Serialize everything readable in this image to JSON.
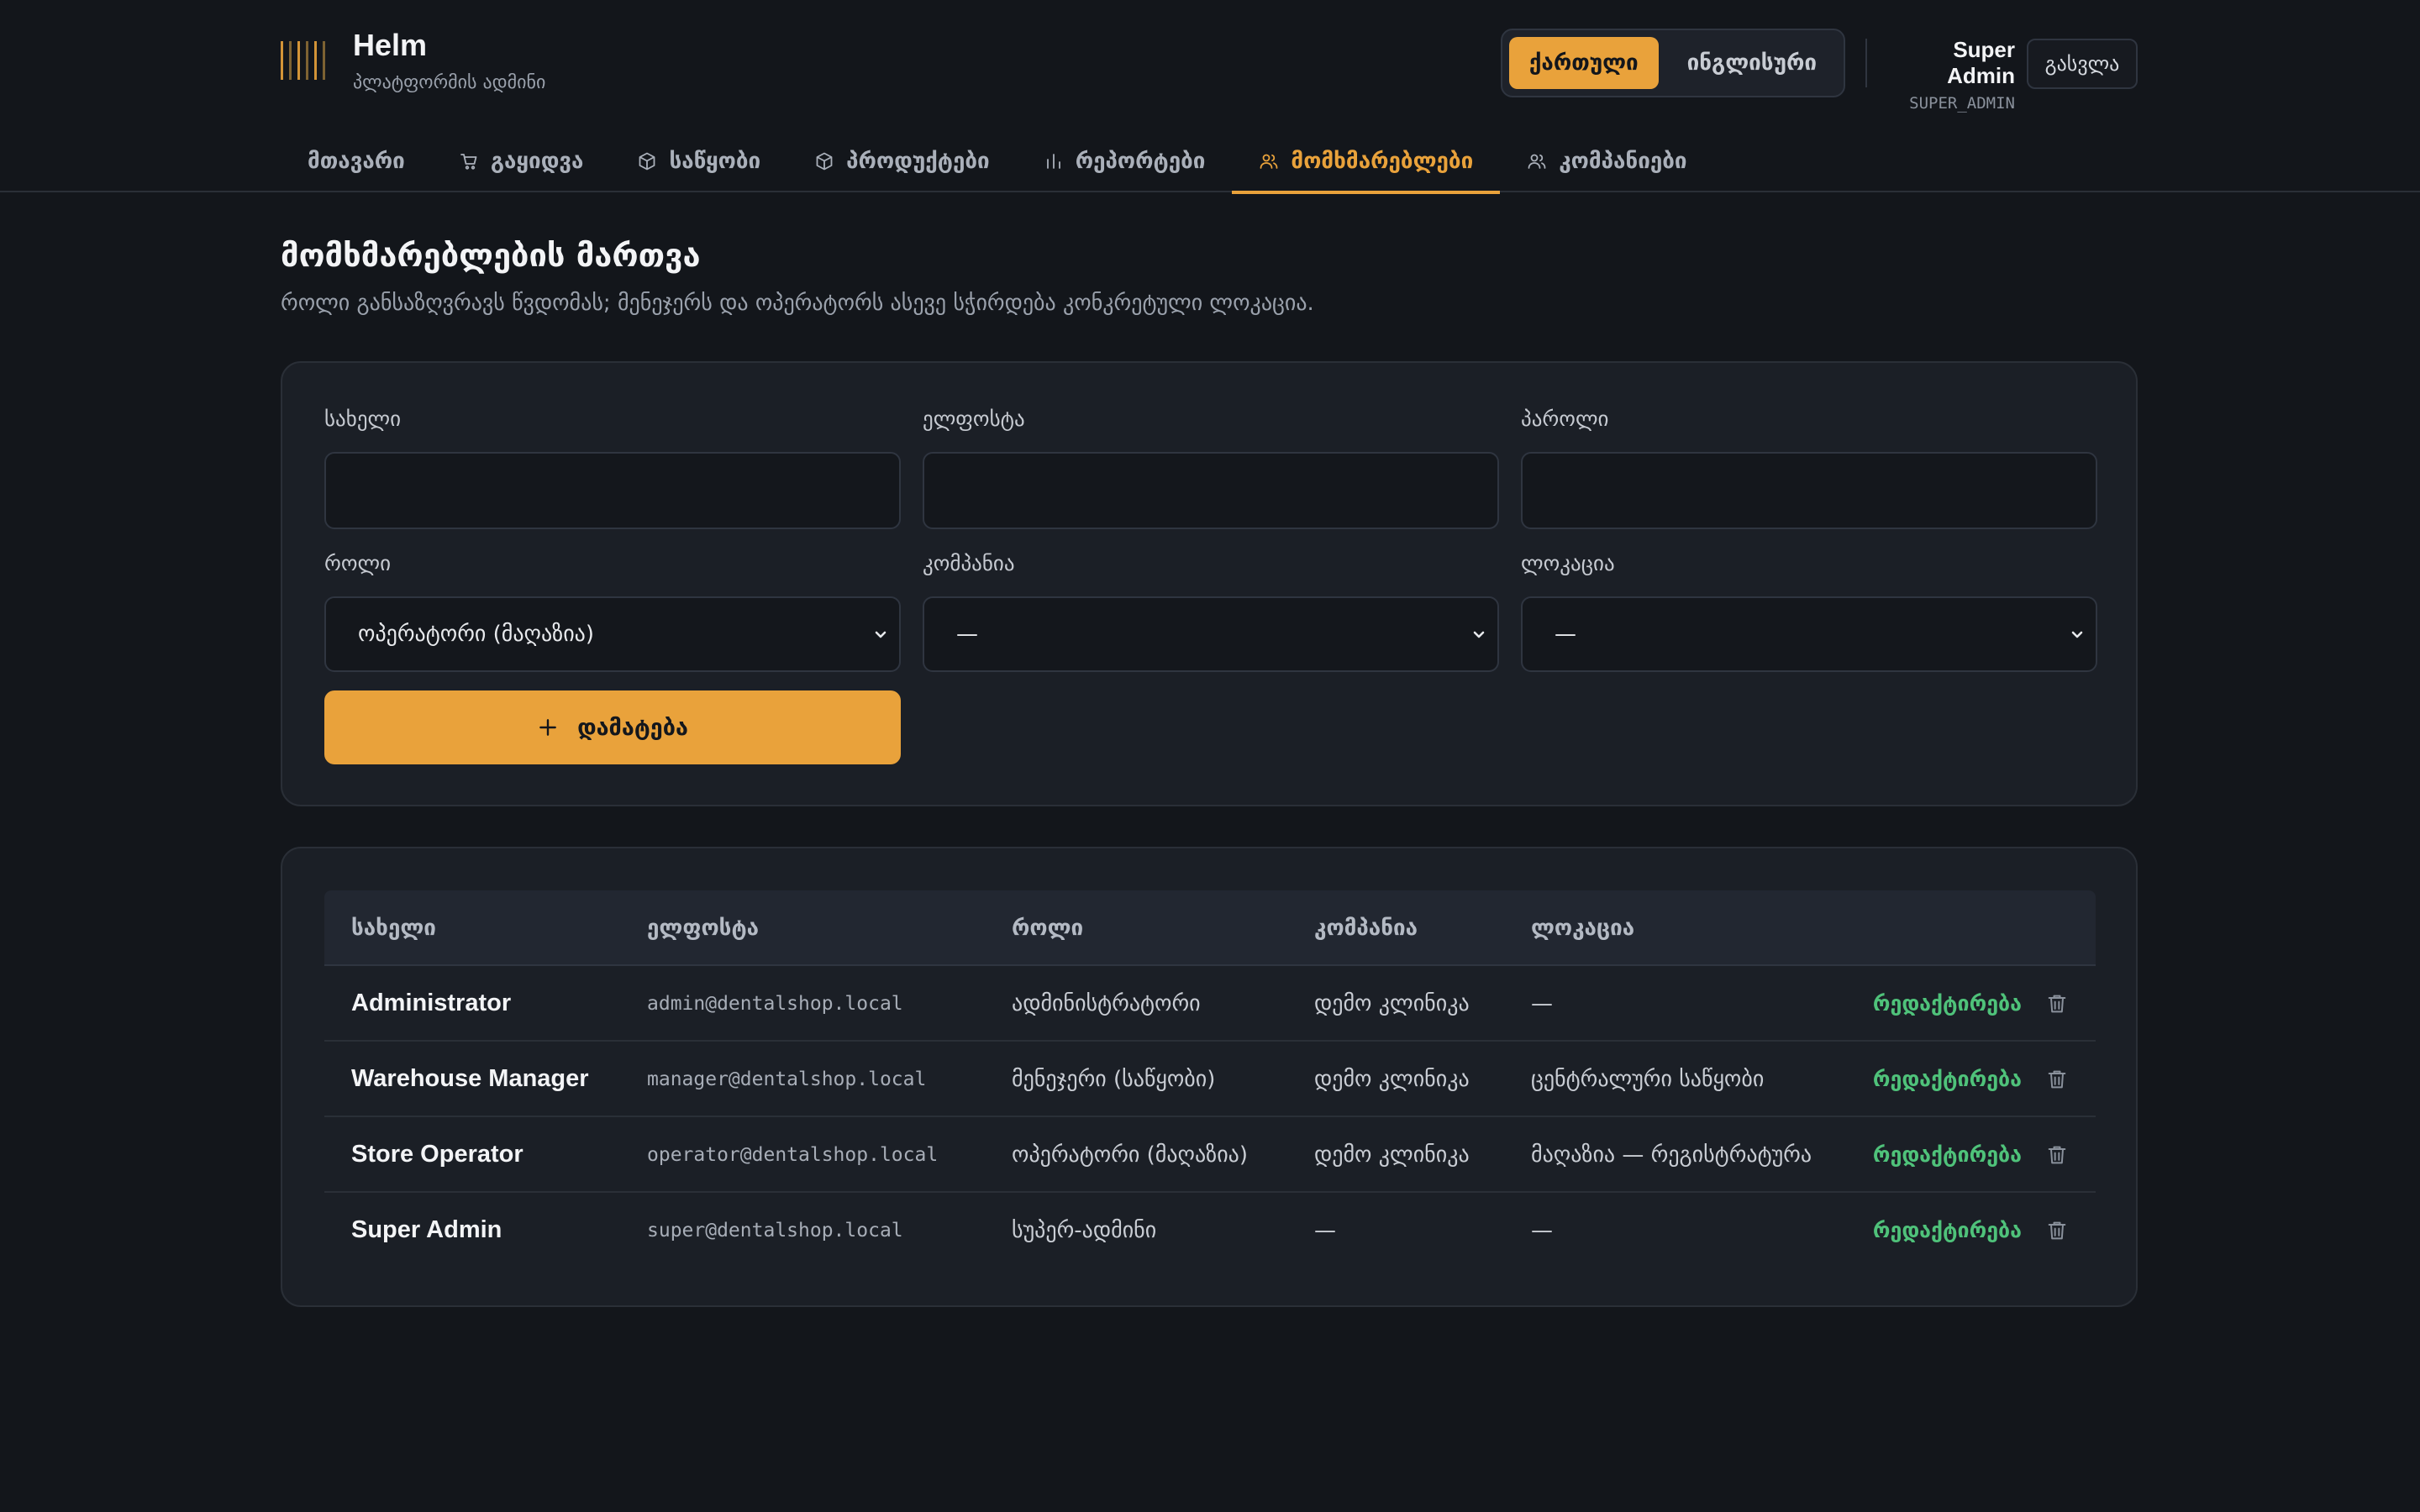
{
  "app": {
    "name": "Helm",
    "subtitle": "პლატფორმის ადმინი"
  },
  "lang": {
    "georgian": "ქართული",
    "english": "ინგლისური"
  },
  "user": {
    "name": "Super Admin",
    "role": "SUPER_ADMIN",
    "logout": "გასვლა"
  },
  "nav": {
    "items": [
      {
        "label": "მთავარი",
        "icon": "none"
      },
      {
        "label": "გაყიდვა",
        "icon": "cart-icon"
      },
      {
        "label": "საწყობი",
        "icon": "box-icon"
      },
      {
        "label": "პროდუქტები",
        "icon": "box-icon"
      },
      {
        "label": "რეპორტები",
        "icon": "chart-icon"
      },
      {
        "label": "მომხმარებლები",
        "icon": "users-icon"
      },
      {
        "label": "კომპანიები",
        "icon": "users-icon"
      }
    ]
  },
  "page": {
    "title": "მომხმარებლების მართვა",
    "subtitle": "როლი განსაზღვრავს წვდომას; მენეჯერს და ოპერატორს ასევე სჭირდება კონკრეტული ლოკაცია."
  },
  "form": {
    "name_label": "სახელი",
    "email_label": "ელფოსტა",
    "password_label": "პაროლი",
    "role_label": "როლი",
    "company_label": "კომპანია",
    "location_label": "ლოკაცია",
    "role_value": "ოპერატორი (მაღაზია)",
    "company_value": "—",
    "location_value": "—",
    "add_button": "დამატება"
  },
  "table": {
    "headers": {
      "name": "სახელი",
      "email": "ელფოსტა",
      "role": "როლი",
      "company": "კომპანია",
      "location": "ლოკაცია"
    },
    "edit_label": "რედაქტირება",
    "rows": [
      {
        "name": "Administrator",
        "email": "admin@dentalshop.local",
        "role": "ადმინისტრატორი",
        "company": "დემო კლინიკა",
        "location": "—"
      },
      {
        "name": "Warehouse Manager",
        "email": "manager@dentalshop.local",
        "role": "მენეჯერი (საწყობი)",
        "company": "დემო კლინიკა",
        "location": "ცენტრალური საწყობი"
      },
      {
        "name": "Store Operator",
        "email": "operator@dentalshop.local",
        "role": "ოპერატორი (მაღაზია)",
        "company": "დემო კლინიკა",
        "location": "მაღაზია — რეგისტრატურა"
      },
      {
        "name": "Super Admin",
        "email": "super@dentalshop.local",
        "role": "სუპერ-ადმინი",
        "company": "—",
        "location": "—"
      }
    ]
  },
  "colors": {
    "accent": "#e9a23b",
    "background": "#13161b",
    "card": "#1b1f26",
    "edit_link": "#4fc27a"
  }
}
